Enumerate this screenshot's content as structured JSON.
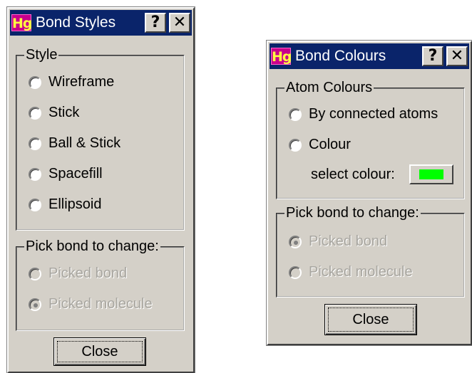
{
  "bond_styles": {
    "icon_text": "Hg",
    "title": "Bond Styles",
    "help_glyph": "?",
    "close_glyph": "✕",
    "style_group": {
      "legend": "Style",
      "options": [
        "Wireframe",
        "Stick",
        "Ball & Stick",
        "Spacefill",
        "Ellipsoid"
      ]
    },
    "pick_group": {
      "legend": "Pick bond to change:",
      "options": [
        "Picked bond",
        "Picked molecule"
      ],
      "selected": "Picked molecule"
    },
    "close_label": "Close"
  },
  "bond_colours": {
    "icon_text": "Hg",
    "title": "Bond Colours",
    "help_glyph": "?",
    "close_glyph": "✕",
    "atom_group": {
      "legend": "Atom Colours",
      "options": [
        "By connected atoms",
        "Colour"
      ],
      "select_label": "select colour:",
      "swatch_color": "#00ff00"
    },
    "pick_group": {
      "legend": "Pick bond to change:",
      "options": [
        "Picked bond",
        "Picked molecule"
      ],
      "selected": "Picked bond"
    },
    "close_label": "Close"
  },
  "colors": {
    "face": "#d4d0c8",
    "titlebar": "#0a246a",
    "disabled_text": "#a8a6a0"
  }
}
